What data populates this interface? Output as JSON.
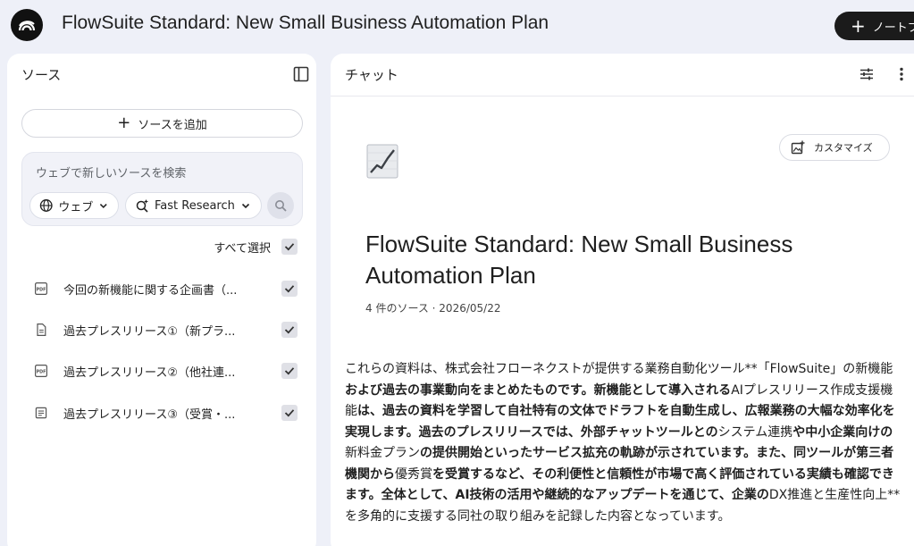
{
  "header": {
    "title": "FlowSuite Standard: New Small Business Automation Plan",
    "new_note_label": "ノートブ"
  },
  "sources_panel": {
    "title": "ソース",
    "add_source_label": "ソースを追加",
    "search_placeholder": "ウェブで新しいソースを検索",
    "web_chip_label": "ウェブ",
    "research_chip_label": "Fast Research",
    "select_all_label": "すべて選択",
    "items": [
      {
        "icon": "pdf-icon",
        "title": "今回の新機能に関する企画書（...",
        "checked": true
      },
      {
        "icon": "doc-icon",
        "title": "過去プレスリリース①（新プラ...",
        "checked": true
      },
      {
        "icon": "pdf-icon",
        "title": "過去プレスリリース②（他社連...",
        "checked": true
      },
      {
        "icon": "text-doc-icon",
        "title": "過去プレスリリース③（受賞・...",
        "checked": true
      }
    ]
  },
  "chat_panel": {
    "title": "チャット",
    "customize_label": "カスタマイズ",
    "notebook_emoji": "📈",
    "notebook_title": "FlowSuite Standard: New Small Business Automation Plan",
    "meta": "4 件のソース · 2026/05/22",
    "summary_segments": [
      {
        "text": "これらの資料は、株式会社フローネクストが提供する業務自動化ツール**「FlowSuite」の新機能",
        "bold": false
      },
      {
        "text": "および過去の事業動向をまとめたものです。新機能として導入される",
        "bold": true
      },
      {
        "text": "AIプレスリリース作成支援機能",
        "bold": false
      },
      {
        "text": "は、過去の資料を学習して自社特有の文体でドラフトを自動生成し、広報業務の大幅な効率化を実現します。過去のプレスリリースでは、外部チャットツールとの",
        "bold": true
      },
      {
        "text": "システム連携",
        "bold": false
      },
      {
        "text": "や中小企業向けの",
        "bold": true
      },
      {
        "text": "新料金プラン",
        "bold": false
      },
      {
        "text": "の提供開始といったサービス拡充の軌跡が示されています。また、同ツールが第三者機関から",
        "bold": true
      },
      {
        "text": "優秀賞",
        "bold": false
      },
      {
        "text": "を受賞するなど、その利便性と信頼性が市場で高く評価されている実績も確認できます。全体として、AI技術の活用や継続的なアップデートを通じて、企業の",
        "bold": true
      },
      {
        "text": "DX推進と生産性向上**を多角的に支援する同社の取り組みを記録した内容となっています。",
        "bold": false
      }
    ]
  }
}
